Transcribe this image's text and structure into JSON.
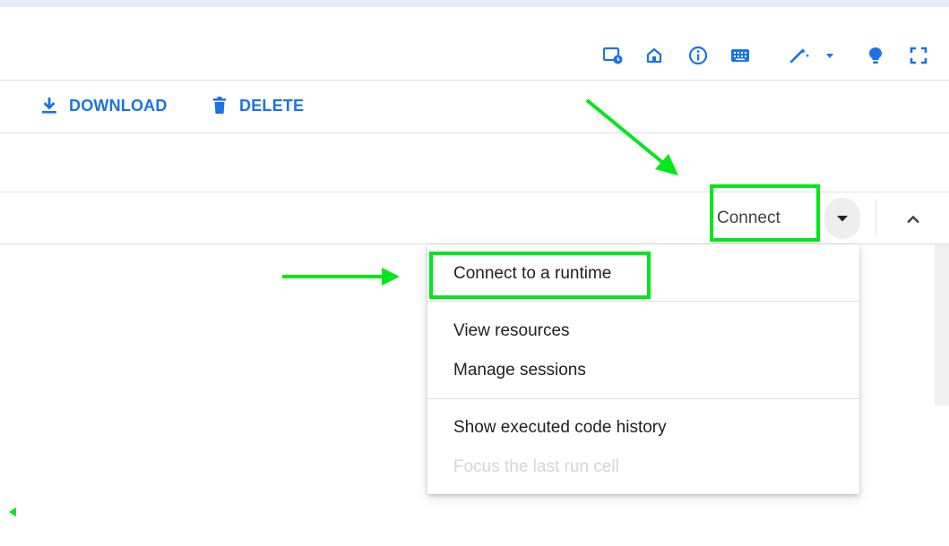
{
  "toolbar": {
    "icons": [
      "runtime-status-icon",
      "home-icon",
      "info-icon",
      "keyboard-icon",
      "magic-wand-icon",
      "dropdown-caret-icon",
      "lightbulb-icon",
      "fullscreen-icon"
    ]
  },
  "actions": {
    "download_label": "DOWNLOAD",
    "delete_label": "DELETE"
  },
  "connect": {
    "label": "Connect"
  },
  "menu": {
    "items": [
      {
        "label": "Connect to a runtime",
        "enabled": true
      },
      {
        "label": "View resources",
        "enabled": true
      },
      {
        "label": "Manage sessions",
        "enabled": true
      },
      {
        "label": "Show executed code history",
        "enabled": true
      },
      {
        "label": "Focus the last run cell",
        "enabled": false
      }
    ]
  },
  "colors": {
    "accent": "#1a73e8",
    "annotation": "#00e81a",
    "text": "#212121",
    "disabled_text": "#d5d5d5",
    "icon": "#1a73e8"
  }
}
